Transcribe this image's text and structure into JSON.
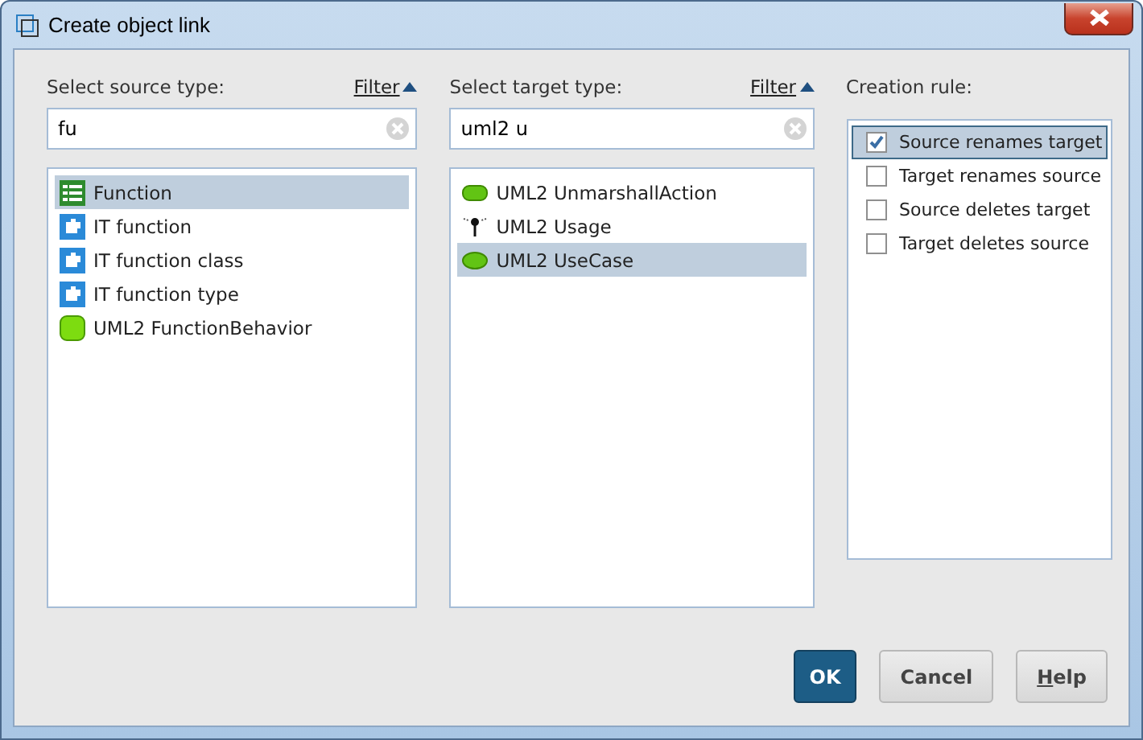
{
  "window": {
    "title": "Create object link"
  },
  "source": {
    "label": "Select source type:",
    "filter": "Filter",
    "search": "fu",
    "items": [
      {
        "label": "Function",
        "kind": "function",
        "selected": true
      },
      {
        "label": "IT function",
        "kind": "it_function",
        "selected": false
      },
      {
        "label": "IT function class",
        "kind": "it_function",
        "selected": false
      },
      {
        "label": "IT function type",
        "kind": "it_function",
        "selected": false
      },
      {
        "label": "UML2 FunctionBehavior",
        "kind": "uml_behavior",
        "selected": false
      }
    ]
  },
  "target": {
    "label": "Select target type:",
    "filter": "Filter",
    "search": "uml2 u",
    "items": [
      {
        "label": "UML2 UnmarshallAction",
        "kind": "uml_action",
        "selected": false
      },
      {
        "label": "UML2 Usage",
        "kind": "uml_usage",
        "selected": false
      },
      {
        "label": "UML2 UseCase",
        "kind": "uml_usecase",
        "selected": true
      }
    ]
  },
  "rules": {
    "label": "Creation rule:",
    "items": [
      {
        "label": "Source renames target",
        "checked": true,
        "selected": true
      },
      {
        "label": "Target renames source",
        "checked": false,
        "selected": false
      },
      {
        "label": "Source deletes target",
        "checked": false,
        "selected": false
      },
      {
        "label": "Target deletes source",
        "checked": false,
        "selected": false
      }
    ]
  },
  "buttons": [
    {
      "label": "OK",
      "kind": "default",
      "mnemonic_underlined": false
    },
    {
      "label": "Cancel",
      "kind": "normal",
      "mnemonic_underlined": false
    },
    {
      "label": "Help",
      "kind": "normal",
      "mnemonic_underlined": true
    }
  ]
}
